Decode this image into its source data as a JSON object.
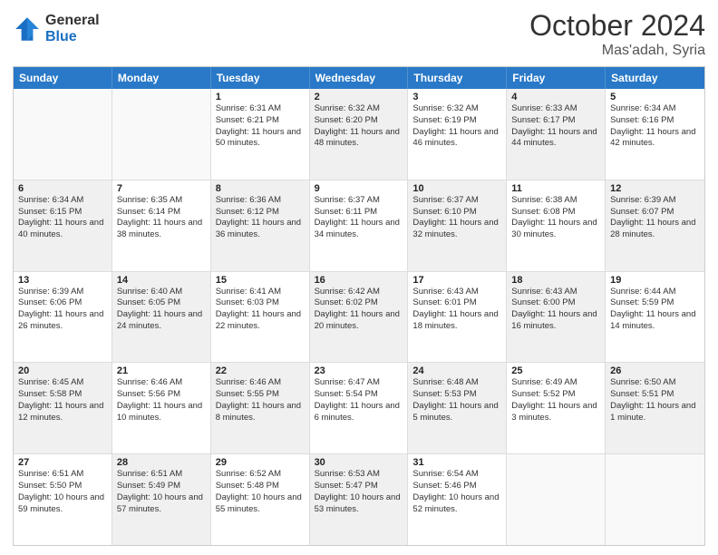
{
  "header": {
    "logo_general": "General",
    "logo_blue": "Blue",
    "month": "October 2024",
    "location": "Mas'adah, Syria"
  },
  "days_of_week": [
    "Sunday",
    "Monday",
    "Tuesday",
    "Wednesday",
    "Thursday",
    "Friday",
    "Saturday"
  ],
  "weeks": [
    [
      {
        "day": "",
        "sunrise": "",
        "sunset": "",
        "daylight": "",
        "shaded": false,
        "empty": true
      },
      {
        "day": "",
        "sunrise": "",
        "sunset": "",
        "daylight": "",
        "shaded": false,
        "empty": true
      },
      {
        "day": "1",
        "sunrise": "Sunrise: 6:31 AM",
        "sunset": "Sunset: 6:21 PM",
        "daylight": "Daylight: 11 hours and 50 minutes.",
        "shaded": false,
        "empty": false
      },
      {
        "day": "2",
        "sunrise": "Sunrise: 6:32 AM",
        "sunset": "Sunset: 6:20 PM",
        "daylight": "Daylight: 11 hours and 48 minutes.",
        "shaded": true,
        "empty": false
      },
      {
        "day": "3",
        "sunrise": "Sunrise: 6:32 AM",
        "sunset": "Sunset: 6:19 PM",
        "daylight": "Daylight: 11 hours and 46 minutes.",
        "shaded": false,
        "empty": false
      },
      {
        "day": "4",
        "sunrise": "Sunrise: 6:33 AM",
        "sunset": "Sunset: 6:17 PM",
        "daylight": "Daylight: 11 hours and 44 minutes.",
        "shaded": true,
        "empty": false
      },
      {
        "day": "5",
        "sunrise": "Sunrise: 6:34 AM",
        "sunset": "Sunset: 6:16 PM",
        "daylight": "Daylight: 11 hours and 42 minutes.",
        "shaded": false,
        "empty": false
      }
    ],
    [
      {
        "day": "6",
        "sunrise": "Sunrise: 6:34 AM",
        "sunset": "Sunset: 6:15 PM",
        "daylight": "Daylight: 11 hours and 40 minutes.",
        "shaded": true,
        "empty": false
      },
      {
        "day": "7",
        "sunrise": "Sunrise: 6:35 AM",
        "sunset": "Sunset: 6:14 PM",
        "daylight": "Daylight: 11 hours and 38 minutes.",
        "shaded": false,
        "empty": false
      },
      {
        "day": "8",
        "sunrise": "Sunrise: 6:36 AM",
        "sunset": "Sunset: 6:12 PM",
        "daylight": "Daylight: 11 hours and 36 minutes.",
        "shaded": true,
        "empty": false
      },
      {
        "day": "9",
        "sunrise": "Sunrise: 6:37 AM",
        "sunset": "Sunset: 6:11 PM",
        "daylight": "Daylight: 11 hours and 34 minutes.",
        "shaded": false,
        "empty": false
      },
      {
        "day": "10",
        "sunrise": "Sunrise: 6:37 AM",
        "sunset": "Sunset: 6:10 PM",
        "daylight": "Daylight: 11 hours and 32 minutes.",
        "shaded": true,
        "empty": false
      },
      {
        "day": "11",
        "sunrise": "Sunrise: 6:38 AM",
        "sunset": "Sunset: 6:08 PM",
        "daylight": "Daylight: 11 hours and 30 minutes.",
        "shaded": false,
        "empty": false
      },
      {
        "day": "12",
        "sunrise": "Sunrise: 6:39 AM",
        "sunset": "Sunset: 6:07 PM",
        "daylight": "Daylight: 11 hours and 28 minutes.",
        "shaded": true,
        "empty": false
      }
    ],
    [
      {
        "day": "13",
        "sunrise": "Sunrise: 6:39 AM",
        "sunset": "Sunset: 6:06 PM",
        "daylight": "Daylight: 11 hours and 26 minutes.",
        "shaded": false,
        "empty": false
      },
      {
        "day": "14",
        "sunrise": "Sunrise: 6:40 AM",
        "sunset": "Sunset: 6:05 PM",
        "daylight": "Daylight: 11 hours and 24 minutes.",
        "shaded": true,
        "empty": false
      },
      {
        "day": "15",
        "sunrise": "Sunrise: 6:41 AM",
        "sunset": "Sunset: 6:03 PM",
        "daylight": "Daylight: 11 hours and 22 minutes.",
        "shaded": false,
        "empty": false
      },
      {
        "day": "16",
        "sunrise": "Sunrise: 6:42 AM",
        "sunset": "Sunset: 6:02 PM",
        "daylight": "Daylight: 11 hours and 20 minutes.",
        "shaded": true,
        "empty": false
      },
      {
        "day": "17",
        "sunrise": "Sunrise: 6:43 AM",
        "sunset": "Sunset: 6:01 PM",
        "daylight": "Daylight: 11 hours and 18 minutes.",
        "shaded": false,
        "empty": false
      },
      {
        "day": "18",
        "sunrise": "Sunrise: 6:43 AM",
        "sunset": "Sunset: 6:00 PM",
        "daylight": "Daylight: 11 hours and 16 minutes.",
        "shaded": true,
        "empty": false
      },
      {
        "day": "19",
        "sunrise": "Sunrise: 6:44 AM",
        "sunset": "Sunset: 5:59 PM",
        "daylight": "Daylight: 11 hours and 14 minutes.",
        "shaded": false,
        "empty": false
      }
    ],
    [
      {
        "day": "20",
        "sunrise": "Sunrise: 6:45 AM",
        "sunset": "Sunset: 5:58 PM",
        "daylight": "Daylight: 11 hours and 12 minutes.",
        "shaded": true,
        "empty": false
      },
      {
        "day": "21",
        "sunrise": "Sunrise: 6:46 AM",
        "sunset": "Sunset: 5:56 PM",
        "daylight": "Daylight: 11 hours and 10 minutes.",
        "shaded": false,
        "empty": false
      },
      {
        "day": "22",
        "sunrise": "Sunrise: 6:46 AM",
        "sunset": "Sunset: 5:55 PM",
        "daylight": "Daylight: 11 hours and 8 minutes.",
        "shaded": true,
        "empty": false
      },
      {
        "day": "23",
        "sunrise": "Sunrise: 6:47 AM",
        "sunset": "Sunset: 5:54 PM",
        "daylight": "Daylight: 11 hours and 6 minutes.",
        "shaded": false,
        "empty": false
      },
      {
        "day": "24",
        "sunrise": "Sunrise: 6:48 AM",
        "sunset": "Sunset: 5:53 PM",
        "daylight": "Daylight: 11 hours and 5 minutes.",
        "shaded": true,
        "empty": false
      },
      {
        "day": "25",
        "sunrise": "Sunrise: 6:49 AM",
        "sunset": "Sunset: 5:52 PM",
        "daylight": "Daylight: 11 hours and 3 minutes.",
        "shaded": false,
        "empty": false
      },
      {
        "day": "26",
        "sunrise": "Sunrise: 6:50 AM",
        "sunset": "Sunset: 5:51 PM",
        "daylight": "Daylight: 11 hours and 1 minute.",
        "shaded": true,
        "empty": false
      }
    ],
    [
      {
        "day": "27",
        "sunrise": "Sunrise: 6:51 AM",
        "sunset": "Sunset: 5:50 PM",
        "daylight": "Daylight: 10 hours and 59 minutes.",
        "shaded": false,
        "empty": false
      },
      {
        "day": "28",
        "sunrise": "Sunrise: 6:51 AM",
        "sunset": "Sunset: 5:49 PM",
        "daylight": "Daylight: 10 hours and 57 minutes.",
        "shaded": true,
        "empty": false
      },
      {
        "day": "29",
        "sunrise": "Sunrise: 6:52 AM",
        "sunset": "Sunset: 5:48 PM",
        "daylight": "Daylight: 10 hours and 55 minutes.",
        "shaded": false,
        "empty": false
      },
      {
        "day": "30",
        "sunrise": "Sunrise: 6:53 AM",
        "sunset": "Sunset: 5:47 PM",
        "daylight": "Daylight: 10 hours and 53 minutes.",
        "shaded": true,
        "empty": false
      },
      {
        "day": "31",
        "sunrise": "Sunrise: 6:54 AM",
        "sunset": "Sunset: 5:46 PM",
        "daylight": "Daylight: 10 hours and 52 minutes.",
        "shaded": false,
        "empty": false
      },
      {
        "day": "",
        "sunrise": "",
        "sunset": "",
        "daylight": "",
        "shaded": true,
        "empty": true
      },
      {
        "day": "",
        "sunrise": "",
        "sunset": "",
        "daylight": "",
        "shaded": false,
        "empty": true
      }
    ]
  ]
}
